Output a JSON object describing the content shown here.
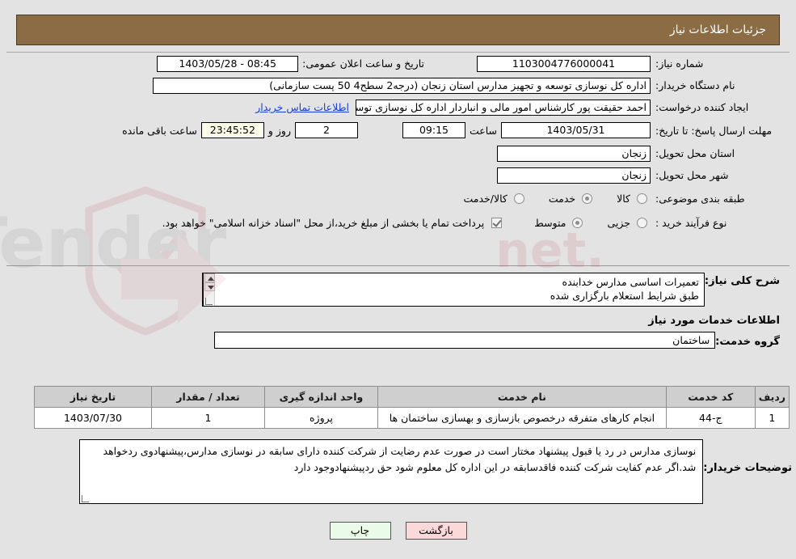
{
  "header": {
    "title": "جزئیات اطلاعات نیاز"
  },
  "form": {
    "need_number_label": "شماره نیاز:",
    "need_number_value": "1103004776000041",
    "announce_datetime_label": "تاریخ و ساعت اعلان عمومی:",
    "announce_datetime_value": "1403/05/28 - 08:45",
    "buyer_org_label": "نام دستگاه خریدار:",
    "buyer_org_value": "اداره کل نوسازی   توسعه و تجهیز مدارس استان زنجان (درجه2  سطح4  50 پست سازمانی)",
    "requester_label": "ایجاد کننده درخواست:",
    "requester_value": "احمد حقیقت پور کارشناس امور مالی و انباردار اداره کل نوسازی   توسعه و تجهیز",
    "contact_link": "اطلاعات تماس خریدار",
    "deadline_label": "مهلت ارسال پاسخ: تا تاریخ:",
    "deadline_date": "1403/05/31",
    "deadline_time_label": "ساعت",
    "deadline_time": "09:15",
    "days_value": "2",
    "days_label": "روز و",
    "countdown_value": "23:45:52",
    "countdown_label": "ساعت باقی مانده",
    "province_label": "استان محل تحویل:",
    "province_value": "زنجان",
    "city_label": "شهر محل تحویل:",
    "city_value": "زنجان",
    "category_label": "طبقه بندی موضوعی:",
    "category_options": [
      {
        "label": "کالا",
        "selected": false
      },
      {
        "label": "خدمت",
        "selected": true
      },
      {
        "label": "کالا/خدمت",
        "selected": false
      }
    ],
    "process_type_label": "نوع فرآیند خرید :",
    "process_type_options": [
      {
        "label": "جزیی",
        "selected": false
      },
      {
        "label": "متوسط",
        "selected": true
      }
    ],
    "treasury_checkbox_checked": true,
    "treasury_note": "پرداخت تمام یا بخشی از مبلغ خرید،از محل \"اسناد خزانه اسلامی\" خواهد بود."
  },
  "description": {
    "label": "شرح کلی نیاز:",
    "line1": "تعمیرات اساسی مدارس خدابنده",
    "line2": "طبق شرایط استعلام بارگزاری شده"
  },
  "services": {
    "section_title": "اطلاعات خدمات مورد نیاز",
    "group_label": "گروه خدمت:",
    "group_value": "ساختمان",
    "table": {
      "columns": [
        "ردیف",
        "کد خدمت",
        "نام خدمت",
        "واحد اندازه گیری",
        "تعداد / مقدار",
        "تاریخ نیاز"
      ],
      "rows": [
        {
          "row": "1",
          "code": "ج-44",
          "name": "انجام کارهای متفرقه درخصوص بازسازی و بهسازی ساختمان ها",
          "unit": "پروژه",
          "quantity": "1",
          "need_date": "1403/07/30"
        }
      ]
    }
  },
  "buyer_notes": {
    "label": "توضیحات خریدار:",
    "text": "نوسازی مدارس در رد یا قبول پیشنهاد مختار است در صورت عدم رضایت از شرکت کننده دارای سابقه در نوسازی مدارس،پیشنهادوی ردخواهد شد.اگر عدم کفایت شرکت کننده فاقدسابقه در این اداره کل معلوم شود حق ردپیشنهادوجود دارد"
  },
  "footer": {
    "print_label": "چاپ",
    "back_label": "بازگشت"
  },
  "colors": {
    "header_bg": "#8b6c45",
    "link": "#1a3fd4",
    "countdown_bg": "#fbfbe8",
    "print_bg": "#ebfbe9",
    "back_bg": "#fbd9d9",
    "table_header_bg": "#cfcfcf"
  }
}
